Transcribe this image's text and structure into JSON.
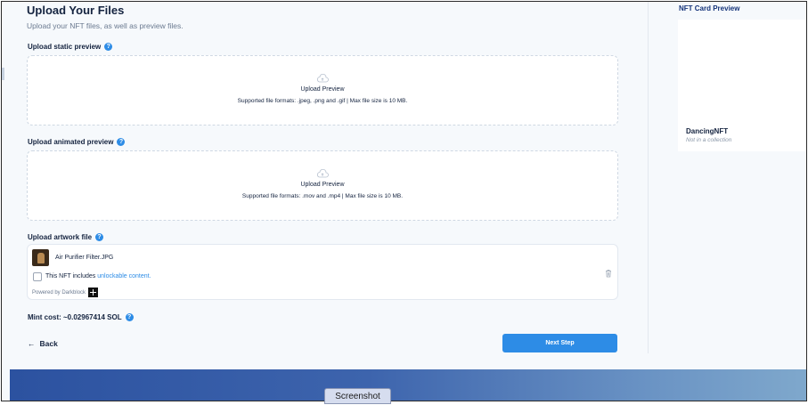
{
  "header": {
    "title": "Upload Your Files",
    "subtitle": "Upload your NFT files, as well as preview files."
  },
  "static_preview": {
    "label": "Upload static preview",
    "help": "?",
    "upload_text": "Upload Preview",
    "formats": "Supported file formats: .jpeg, .png and .gif | Max file size is 10 MB."
  },
  "animated_preview": {
    "label": "Upload animated preview",
    "help": "?",
    "upload_text": "Upload Preview",
    "formats": "Supported file formats: .mov and .mp4 | Max file size is 10 MB."
  },
  "artwork": {
    "label": "Upload artwork file",
    "help": "?",
    "filename": "Air Purifier Filter.JPG",
    "unlockable_prefix": "This NFT includes ",
    "unlockable_link": "unlockable content.",
    "powered_by": "Powered by Darkblock",
    "icons": {
      "thumbnail": "file-thumbnail",
      "delete": "trash-icon",
      "brand": "darkblock-logo"
    }
  },
  "mint": {
    "text": "Mint cost: ~0.02967414 SOL",
    "help": "?"
  },
  "nav": {
    "back_arrow": "←",
    "back_label": "Back",
    "next_label": "Next Step"
  },
  "preview_card": {
    "heading": "NFT Card Preview",
    "name": "DancingNFT",
    "collection": "Not in a collection"
  },
  "overlay": {
    "screenshot_label": "Screenshot"
  },
  "colors": {
    "accent": "#2d8ce6",
    "text_dark": "#14233f",
    "muted": "#6b7a90",
    "page_bg": "#f6f9fc",
    "banner_start": "#2c52a0",
    "banner_end": "#7fa8cc"
  }
}
